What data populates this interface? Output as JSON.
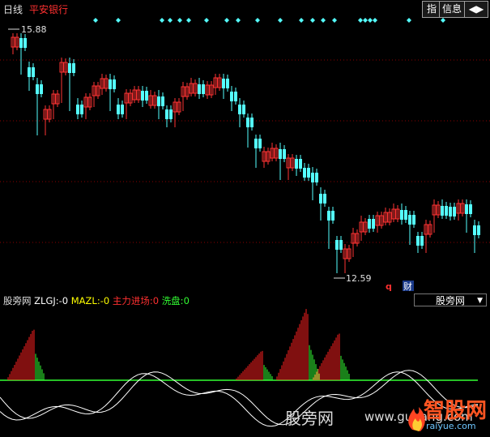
{
  "header": {
    "period": "日线",
    "stock_name": "平安银行",
    "buttons": [
      "指",
      "信息",
      "◀▶"
    ]
  },
  "main_chart": {
    "high_label": "15.88",
    "low_label": "12.59",
    "marker_q": "q",
    "marker_cai": "财",
    "colors": {
      "up": "#ff3333",
      "down": "#54ffff",
      "grid": "#8b0000",
      "marker": "#54ffff"
    }
  },
  "indicator": {
    "name": "股旁网",
    "zlgj_label": "ZLGJ:",
    "zlgj_value": "-0",
    "mazl_label": "MAZL:",
    "mazl_value": "-0",
    "zljc_label": "主力进场:",
    "zljc_value": "0",
    "xp_label": "洗盘:",
    "xp_value": "0",
    "selected": "股旁网"
  },
  "watermark": {
    "text": "股旁网",
    "site": "www.gupang.com",
    "logo_text": "智股网",
    "logo_sub": "raiyue.com"
  }
}
